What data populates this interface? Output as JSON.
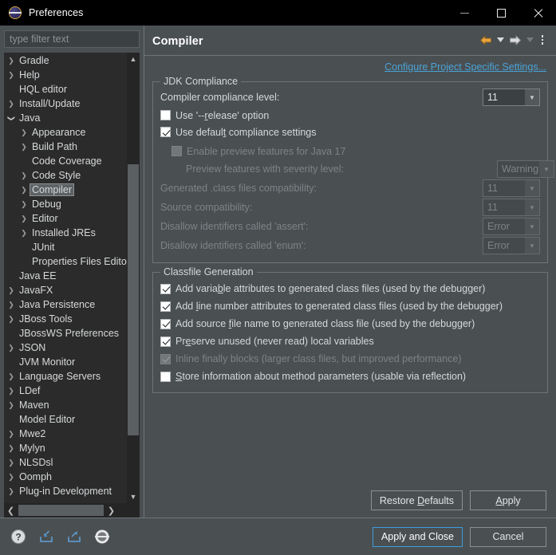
{
  "window": {
    "title": "Preferences",
    "icon": "eclipse-icon",
    "minimize_label": "Minimize",
    "maximize_label": "Maximize",
    "close_label": "Close"
  },
  "sidebar": {
    "filter_placeholder": "type filter text",
    "filter_value": "",
    "items": [
      {
        "label": "Gradle",
        "indent": 0,
        "twisty": "collapsed",
        "selected": false
      },
      {
        "label": "Help",
        "indent": 0,
        "twisty": "collapsed",
        "selected": false
      },
      {
        "label": "HQL editor",
        "indent": 0,
        "twisty": "none",
        "selected": false
      },
      {
        "label": "Install/Update",
        "indent": 0,
        "twisty": "collapsed",
        "selected": false
      },
      {
        "label": "Java",
        "indent": 0,
        "twisty": "expanded",
        "selected": false
      },
      {
        "label": "Appearance",
        "indent": 1,
        "twisty": "collapsed",
        "selected": false
      },
      {
        "label": "Build Path",
        "indent": 1,
        "twisty": "collapsed",
        "selected": false
      },
      {
        "label": "Code Coverage",
        "indent": 1,
        "twisty": "none",
        "selected": false
      },
      {
        "label": "Code Style",
        "indent": 1,
        "twisty": "collapsed",
        "selected": false
      },
      {
        "label": "Compiler",
        "indent": 1,
        "twisty": "collapsed",
        "selected": true
      },
      {
        "label": "Debug",
        "indent": 1,
        "twisty": "collapsed",
        "selected": false
      },
      {
        "label": "Editor",
        "indent": 1,
        "twisty": "collapsed",
        "selected": false
      },
      {
        "label": "Installed JREs",
        "indent": 1,
        "twisty": "collapsed",
        "selected": false
      },
      {
        "label": "JUnit",
        "indent": 1,
        "twisty": "none",
        "selected": false
      },
      {
        "label": "Properties Files Editor",
        "indent": 1,
        "twisty": "none",
        "selected": false
      },
      {
        "label": "Java EE",
        "indent": 0,
        "twisty": "none",
        "selected": false
      },
      {
        "label": "JavaFX",
        "indent": 0,
        "twisty": "collapsed",
        "selected": false
      },
      {
        "label": "Java Persistence",
        "indent": 0,
        "twisty": "collapsed",
        "selected": false
      },
      {
        "label": "JBoss Tools",
        "indent": 0,
        "twisty": "collapsed",
        "selected": false
      },
      {
        "label": "JBossWS Preferences",
        "indent": 0,
        "twisty": "none",
        "selected": false
      },
      {
        "label": "JSON",
        "indent": 0,
        "twisty": "collapsed",
        "selected": false
      },
      {
        "label": "JVM Monitor",
        "indent": 0,
        "twisty": "none",
        "selected": false
      },
      {
        "label": "Language Servers",
        "indent": 0,
        "twisty": "collapsed",
        "selected": false
      },
      {
        "label": "LDef",
        "indent": 0,
        "twisty": "collapsed",
        "selected": false
      },
      {
        "label": "Maven",
        "indent": 0,
        "twisty": "collapsed",
        "selected": false
      },
      {
        "label": "Model Editor",
        "indent": 0,
        "twisty": "none",
        "selected": false
      },
      {
        "label": "Mwe2",
        "indent": 0,
        "twisty": "collapsed",
        "selected": false
      },
      {
        "label": "Mylyn",
        "indent": 0,
        "twisty": "collapsed",
        "selected": false
      },
      {
        "label": "NLSDsl",
        "indent": 0,
        "twisty": "collapsed",
        "selected": false
      },
      {
        "label": "Oomph",
        "indent": 0,
        "twisty": "collapsed",
        "selected": false
      },
      {
        "label": "Plug-in Development",
        "indent": 0,
        "twisty": "collapsed",
        "selected": false
      }
    ]
  },
  "page": {
    "title": "Compiler",
    "configure_link": "Configure Project Specific Settings...",
    "nav": {
      "back_label": "Back",
      "back_menu_label": "Back history",
      "forward_label": "Forward",
      "forward_menu_label": "Forward history",
      "view_menu_label": "View Menu"
    },
    "jdk_compliance": {
      "title": "JDK Compliance",
      "compliance_level_label": "Compiler compliance level:",
      "compliance_level_value": "11",
      "use_release_label": "Use '--release' option",
      "use_release_checked": false,
      "use_default_label": "Use default compliance settings",
      "use_default_checked": true,
      "enable_preview_label": "Enable preview features for Java 17",
      "enable_preview_checked": false,
      "preview_severity_label": "Preview features with severity level:",
      "preview_severity_value": "Warning",
      "generated_class_label": "Generated .class files compatibility:",
      "generated_class_value": "11",
      "source_compat_label": "Source compatibility:",
      "source_compat_value": "11",
      "disallow_assert_label": "Disallow identifiers called 'assert':",
      "disallow_assert_value": "Error",
      "disallow_enum_label": "Disallow identifiers called 'enum':",
      "disallow_enum_value": "Error"
    },
    "classfile_generation": {
      "title": "Classfile Generation",
      "options": [
        {
          "label": "Add variable attributes to generated class files (used by the debugger)",
          "checked": true,
          "enabled": true
        },
        {
          "label": "Add line number attributes to generated class files (used by the debugger)",
          "checked": true,
          "enabled": true
        },
        {
          "label": "Add source file name to generated class file (used by the debugger)",
          "checked": true,
          "enabled": true
        },
        {
          "label": "Preserve unused (never read) local variables",
          "checked": true,
          "enabled": true
        },
        {
          "label": "Inline finally blocks (larger class files, but improved performance)",
          "checked": true,
          "enabled": false
        },
        {
          "label": "Store information about method parameters (usable via reflection)",
          "checked": false,
          "enabled": true
        }
      ]
    },
    "buttons": {
      "restore_defaults": "Restore Defaults",
      "apply": "Apply"
    }
  },
  "footer": {
    "icons": [
      {
        "name": "help-icon",
        "title": "Help"
      },
      {
        "name": "import-icon",
        "title": "Import preferences"
      },
      {
        "name": "export-icon",
        "title": "Export preferences"
      },
      {
        "name": "oomph-icon",
        "title": "Oomph preference recorder"
      }
    ],
    "apply_and_close": "Apply and Close",
    "cancel": "Cancel"
  },
  "colors": {
    "window_bg": "#4a4f52",
    "titlebar_bg": "#000000",
    "tree_bg": "#2b2b2b",
    "text": "#d6d8da",
    "link": "#4aa3d6",
    "accent_focus": "#3a9fdc",
    "back_arrow": "#e8a33d",
    "forward_arrow": "#d9dbdd",
    "disabled_text": "#7e8386"
  }
}
